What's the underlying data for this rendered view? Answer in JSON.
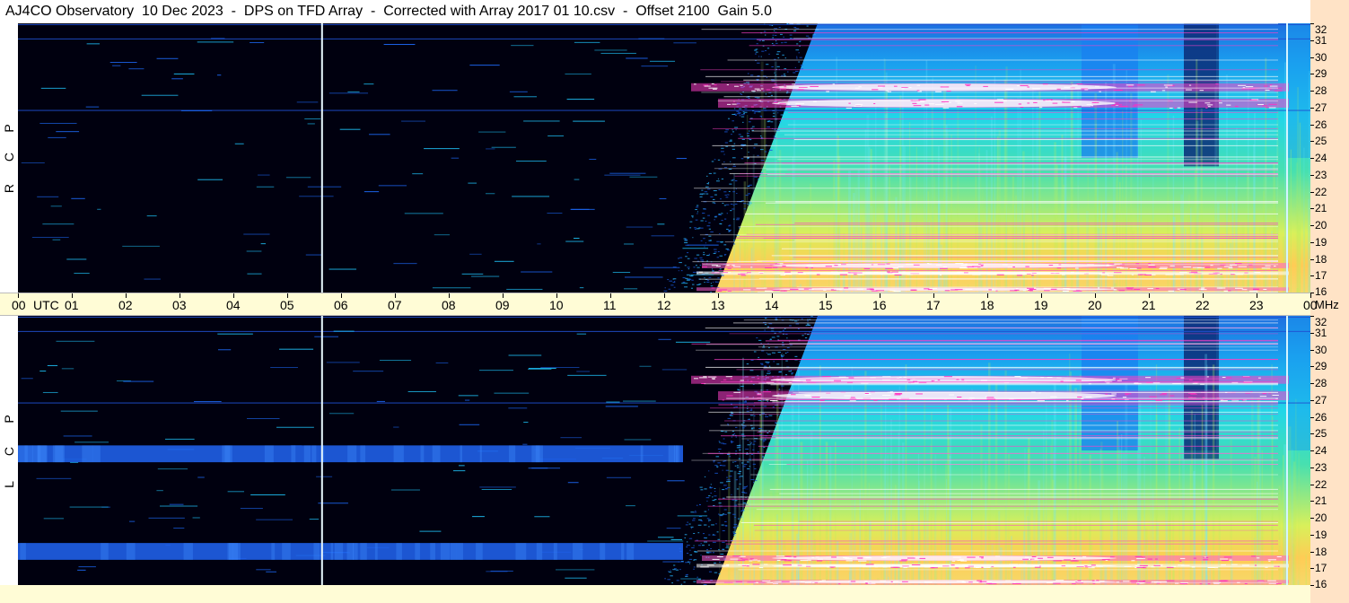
{
  "title": "AJ4CO Observatory  10 Dec 2023  -  DPS on TFD Array  -  Corrected with Array 2017 01 10.csv  -  Offset 2100  Gain 5.0",
  "time_axis": {
    "labels": [
      "00",
      "01",
      "02",
      "03",
      "04",
      "05",
      "06",
      "07",
      "08",
      "09",
      "10",
      "11",
      "12",
      "13",
      "14",
      "15",
      "16",
      "17",
      "18",
      "19",
      "20",
      "21",
      "22",
      "23",
      "00"
    ],
    "utc_label": "UTC",
    "unit_label": "MHz"
  },
  "panels": [
    {
      "polarization_letters": [
        "R",
        "C",
        "P"
      ]
    },
    {
      "polarization_letters": [
        "L",
        "C",
        "P"
      ]
    }
  ],
  "colors": {
    "background": "#00000f",
    "axis_bg": "#fffcd6",
    "right_strip": "#ffe3c6"
  },
  "chart_data": {
    "type": "heatmap",
    "title": "AJ4CO Observatory  10 Dec 2023  -  DPS on TFD Array  -  Corrected with Array 2017 01 10.csv  -  Offset 2100  Gain 5.0",
    "x_ticks": [
      "00",
      "01",
      "02",
      "03",
      "04",
      "05",
      "06",
      "07",
      "08",
      "09",
      "10",
      "11",
      "12",
      "13",
      "14",
      "15",
      "16",
      "17",
      "18",
      "19",
      "20",
      "21",
      "22",
      "23",
      "00"
    ],
    "x_unit": "UTC",
    "y_unit": "MHz",
    "y_ticks": [
      32,
      31,
      30,
      29,
      28,
      27,
      26,
      25,
      24,
      23,
      22,
      21,
      20,
      19,
      18,
      17,
      16
    ],
    "ylim": [
      16,
      32
    ],
    "xlim_hours": [
      0,
      24
    ],
    "panels": [
      "RCP",
      "LCP"
    ]
  }
}
